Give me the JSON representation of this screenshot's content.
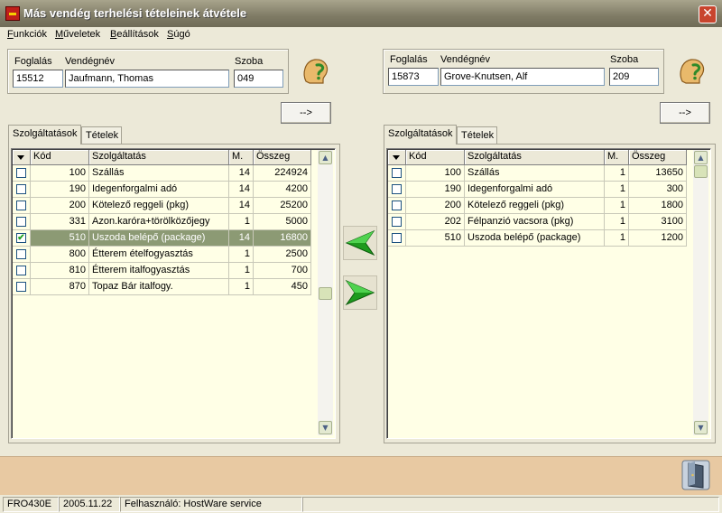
{
  "window": {
    "title": "Más vendég terhelési tételeinek átvétele",
    "close_glyph": "✕"
  },
  "menu": [
    "Funkciók",
    "Műveletek",
    "Beállítások",
    "Súgó"
  ],
  "left": {
    "labels": {
      "booking": "Foglalás",
      "guest": "Vendégnév",
      "room": "Szoba"
    },
    "booking": "15512",
    "guest": "Jaufmann, Thomas",
    "room": "049",
    "transfer_button": "-->",
    "tabs": [
      "Szolgáltatások",
      "Tételek"
    ],
    "columns": [
      "Kód",
      "Szolgáltatás",
      "M.",
      "Összeg"
    ],
    "rows": [
      {
        "checked": false,
        "code": "100",
        "service": "Szállás",
        "qty": "14",
        "amount": "224924"
      },
      {
        "checked": false,
        "code": "190",
        "service": "Idegenforgalmi adó",
        "qty": "14",
        "amount": "4200"
      },
      {
        "checked": false,
        "code": "200",
        "service": "Kötelező reggeli (pkg)",
        "qty": "14",
        "amount": "25200"
      },
      {
        "checked": false,
        "code": "331",
        "service": "Azon.karóra+törölközőjegy",
        "qty": "1",
        "amount": "5000"
      },
      {
        "checked": true,
        "code": "510",
        "service": "Uszoda belépő (package)",
        "qty": "14",
        "amount": "16800"
      },
      {
        "checked": false,
        "code": "800",
        "service": "Étterem ételfogyasztás",
        "qty": "1",
        "amount": "2500"
      },
      {
        "checked": false,
        "code": "810",
        "service": "Étterem italfogyasztás",
        "qty": "1",
        "amount": "700"
      },
      {
        "checked": false,
        "code": "870",
        "service": "Topaz Bár italfogy.",
        "qty": "1",
        "amount": "450"
      }
    ]
  },
  "right": {
    "labels": {
      "booking": "Foglalás",
      "guest": "Vendégnév",
      "room": "Szoba"
    },
    "booking": "15873",
    "guest": "Grove-Knutsen, Alf",
    "room": "209",
    "transfer_button": "-->",
    "tabs": [
      "Szolgáltatások",
      "Tételek"
    ],
    "columns": [
      "Kód",
      "Szolgáltatás",
      "M.",
      "Összeg"
    ],
    "rows": [
      {
        "checked": false,
        "code": "100",
        "service": "Szállás",
        "qty": "1",
        "amount": "13650"
      },
      {
        "checked": false,
        "code": "190",
        "service": "Idegenforgalmi adó",
        "qty": "1",
        "amount": "300"
      },
      {
        "checked": false,
        "code": "200",
        "service": "Kötelező reggeli (pkg)",
        "qty": "1",
        "amount": "1800"
      },
      {
        "checked": false,
        "code": "202",
        "service": "Félpanzió vacsora (pkg)",
        "qty": "1",
        "amount": "3100"
      },
      {
        "checked": false,
        "code": "510",
        "service": "Uszoda belépő (package)",
        "qty": "1",
        "amount": "1200"
      }
    ]
  },
  "icons": {
    "help": "help-question-icon",
    "move_left": "arrow-left-icon",
    "move_right": "arrow-right-icon",
    "exit": "exit-door-icon"
  },
  "colors": {
    "selected_row": "#8C9A74",
    "grid_background": "#FFFFE6",
    "footer": "#E8C9A2",
    "arrow_green": "#1E9A1E"
  },
  "status": {
    "code": "FRO430E",
    "date": "2005.11.22",
    "user": "Felhasználó: HostWare service"
  }
}
